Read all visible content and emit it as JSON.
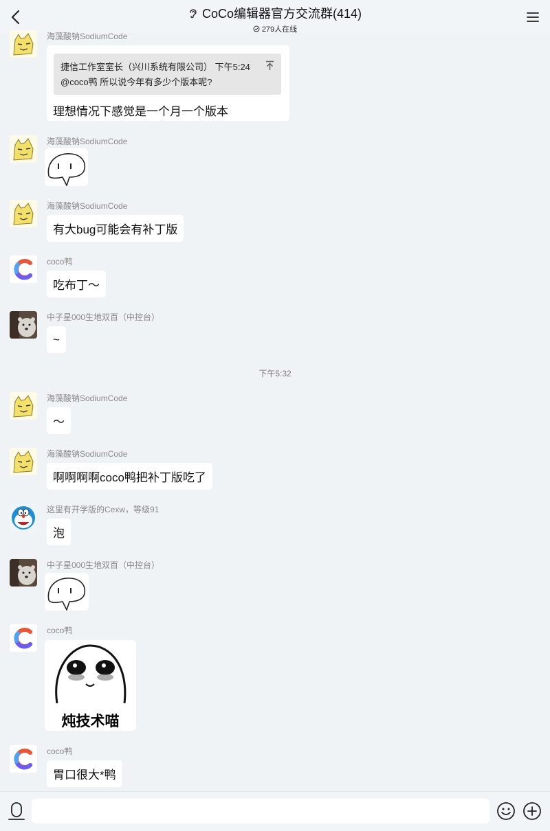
{
  "header": {
    "title": "CoCo编辑器官方交流群(414)",
    "online": "279人在线"
  },
  "messages": [
    {
      "sender": "海藻酸钠SodiumCode",
      "quote_head": "捷信工作室室长（兴川系统有限公司）  下午5:24",
      "quote_text": "@coco鸭 所以说今年有多少个版本呢?",
      "text": "理想情况下感觉是一个月一个版本"
    },
    {
      "sender": "海藻酸钠SodiumCode"
    },
    {
      "sender": "海藻酸钠SodiumCode",
      "text": "有大bug可能会有补丁版"
    },
    {
      "sender": "coco鸭",
      "text": "吃布丁～"
    },
    {
      "sender": "中子星000生地双百（中控台）",
      "text": "~"
    },
    {
      "sender": "海藻酸钠SodiumCode",
      "text": "～"
    },
    {
      "sender": "海藻酸钠SodiumCode",
      "text": "啊啊啊啊coco鸭把补丁版吃了"
    },
    {
      "sender": "这里有开学版的Cexw，等级91",
      "text": "泡"
    },
    {
      "sender": "中子星000生地双百（中控台）"
    },
    {
      "sender": "coco鸭",
      "sticker_caption": "炖技术喵"
    },
    {
      "sender": "coco鸭",
      "text": "胃口很大*鸭"
    }
  ],
  "time_separator": "下午5:32",
  "input": {
    "placeholder": ""
  },
  "icons": [
    "back-icon",
    "ear-icon",
    "online-icon",
    "menu-icon",
    "pin-icon",
    "voice-icon",
    "emoji-icon",
    "plus-icon"
  ],
  "colors": {
    "background": "#f0f3f6",
    "bubble": "#ffffff",
    "sender": "#888888",
    "quote": "#e6e6e6"
  }
}
